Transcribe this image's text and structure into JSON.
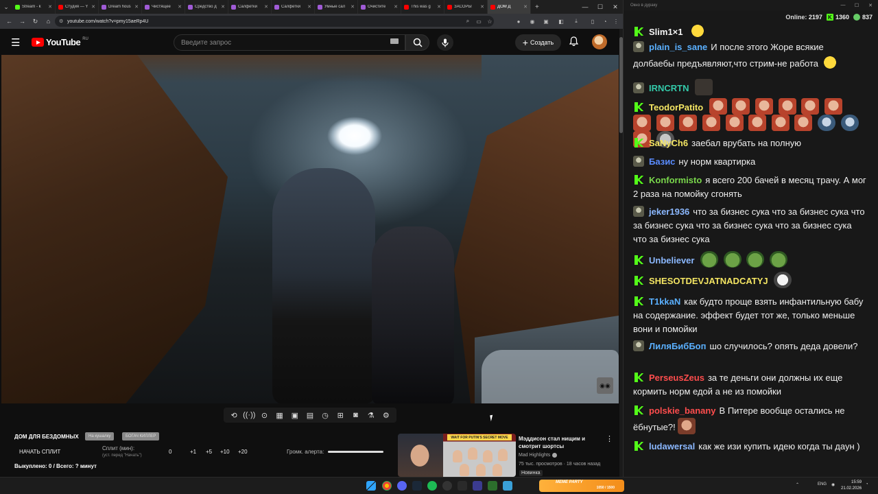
{
  "browser": {
    "tabs": [
      {
        "title": "Stream - k",
        "color": "#53fc18"
      },
      {
        "title": "Студия — Y",
        "color": "#ff0000"
      },
      {
        "title": "Dream hous",
        "color": "#a05bd6"
      },
      {
        "title": "Чистящее",
        "color": "#a05bd6"
      },
      {
        "title": "Средство д",
        "color": "#a05bd6"
      },
      {
        "title": "Салфетки",
        "color": "#a05bd6"
      },
      {
        "title": "Салфетки",
        "color": "#a05bd6"
      },
      {
        "title": "Умные сал",
        "color": "#a05bd6"
      },
      {
        "title": "Очистите",
        "color": "#a05bd6"
      },
      {
        "title": "This was g",
        "color": "#ff0000"
      },
      {
        "title": "ЗАСОРЫ",
        "color": "#ff0000"
      },
      {
        "title": "ДОМ Д",
        "color": "#ff0000"
      }
    ],
    "url": "youtube.com/watch?v=pmy15aeRp4U"
  },
  "youtube": {
    "logo_text": "YouTube",
    "region": "RU",
    "search_placeholder": "Введите запрос",
    "create_label": "Создать"
  },
  "ext": {
    "title": "ДОМ ДЛЯ БЕЗДОМНЫХ",
    "pill1": "На кушалку",
    "pill2": "БОГАЧ КИЛЛЕР",
    "start_split": "НАЧАТЬ СПЛИТ",
    "split_label": "Сплит (мин):",
    "split_hint": "(уст. перед \"Начать\")",
    "split_values": [
      "0",
      "+1",
      "+5",
      "+10",
      "+20"
    ],
    "alert_volume_label": "Громк. алерта:",
    "bought": "Выкуплено: 0 / Всего: ? минут"
  },
  "shorts": {
    "banner": "WAIT FOR PUTIN'S SECRET MOVE",
    "title": "Мэддисон стал нищим и смотрит шортсы",
    "channel": "Mad Highlights",
    "meta": "75 тыс. просмотров · 18 часов назад",
    "badge": "Новинка"
  },
  "chat": {
    "window_title": "Окно в дураку",
    "online_label": "Online:",
    "online": "2197",
    "kick_count": "1360",
    "other_count": "837",
    "messages": [
      {
        "badge": "k",
        "user": "Slim1×1",
        "color": "#f5f5f5",
        "text": ""
      },
      {
        "badge": "p",
        "user": "plain_is_sane",
        "color": "#5ab0ff",
        "text": "И после этого Жоре всякие долбаебы предъявляют,что стрим-не работа"
      },
      {
        "badge": "p",
        "user": "IRNCRTN",
        "color": "#33c9a9",
        "text": ""
      },
      {
        "badge": "k",
        "user": "TeodorPatito",
        "color": "#f5e663",
        "text": ""
      },
      {
        "badge": "k",
        "user": "SaNyCh6",
        "color": "#f5e663",
        "text": "заебал врубать на полную"
      },
      {
        "badge": "p",
        "user": "Базис",
        "color": "#5a8cff",
        "text": "ну норм квартирка"
      },
      {
        "badge": "k",
        "user": "Konformisto",
        "color": "#7ad84c",
        "text": "я всего 200 бачей в месяц трачу. А мог 2 раза на помойку сгонять"
      },
      {
        "badge": "p",
        "user": "jeker1936",
        "color": "#8bb8ff",
        "text": "что за бизнес сука что за бизнес сука что за бизнес сука что за бизнес сука что за бизнес сука что за бизнес сука"
      },
      {
        "badge": "k",
        "user": "Unbeliever",
        "color": "#8bb8ff",
        "text": ""
      },
      {
        "badge": "k",
        "user": "SHESOTDEVJATNADCATYJ",
        "color": "#f5e663",
        "text": ""
      },
      {
        "badge": "k",
        "user": "T1kkaN",
        "color": "#5ab0ff",
        "text": "как будто проще взять инфантильную бабу на содержание. эффект будет тот же, только меньше вони и помойки"
      },
      {
        "badge": "p",
        "user": "ЛиляБибБоп",
        "color": "#5ab0ff",
        "text": "шо случилось? опять деда довели?"
      },
      {
        "badge": "k",
        "user": "PerseusZeus",
        "color": "#ff4d4d",
        "text": "за те деньги они должны их еще кормить норм едой а не из помойки"
      },
      {
        "badge": "k",
        "user": "polskie_banany",
        "color": "#ff4d4d",
        "text": "В Питере вообще остались не ёбнутые?!"
      },
      {
        "badge": "k",
        "user": "ludawersal",
        "color": "#8bb8ff",
        "text": "как же изи купить идею когда ты даун )"
      }
    ]
  },
  "taskbar": {
    "game_title": "MEME PARTY",
    "game_progress": "1050 / 1500",
    "lang": "ENG",
    "time": "15:59",
    "date": "21.02.2026"
  }
}
